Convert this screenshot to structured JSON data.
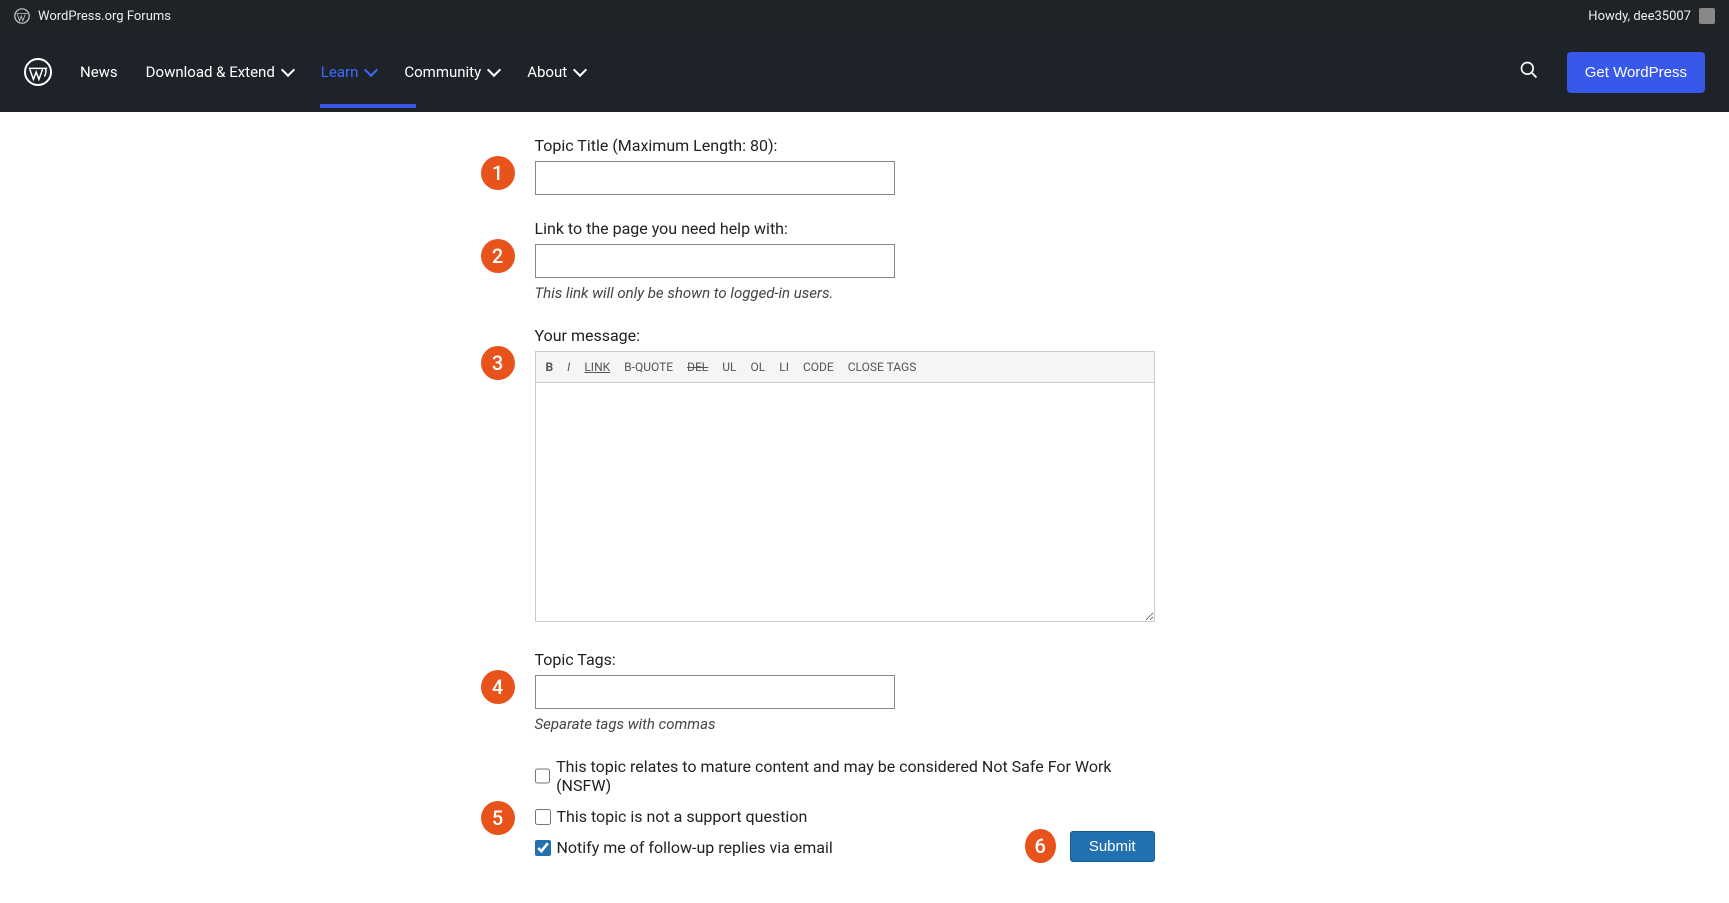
{
  "admin_bar": {
    "site_title": "WordPress.org Forums",
    "howdy": "Howdy, dee35007"
  },
  "nav": {
    "items": [
      "News",
      "Download & Extend",
      "Learn",
      "Community",
      "About"
    ],
    "get_wp": "Get WordPress"
  },
  "form": {
    "title_label": "Topic Title (Maximum Length: 80):",
    "link_label": "Link to the page you need help with:",
    "link_hint": "This link will only be shown to logged-in users.",
    "message_label": "Your message:",
    "tags_label": "Topic Tags:",
    "tags_hint": "Separate tags with commas",
    "nsfw_label": "This topic relates to mature content and may be considered Not Safe For Work (NSFW)",
    "not_support_label": "This topic is not a support question",
    "notify_label": "Notify me of follow-up replies via email",
    "submit": "Submit"
  },
  "toolbar": {
    "b": "B",
    "i": "I",
    "link": "LINK",
    "bquote": "B-QUOTE",
    "del": "DEL",
    "ul": "UL",
    "ol": "OL",
    "li": "LI",
    "code": "CODE",
    "close": "CLOSE TAGS"
  },
  "badges": [
    "1",
    "2",
    "3",
    "4",
    "5",
    "6"
  ]
}
